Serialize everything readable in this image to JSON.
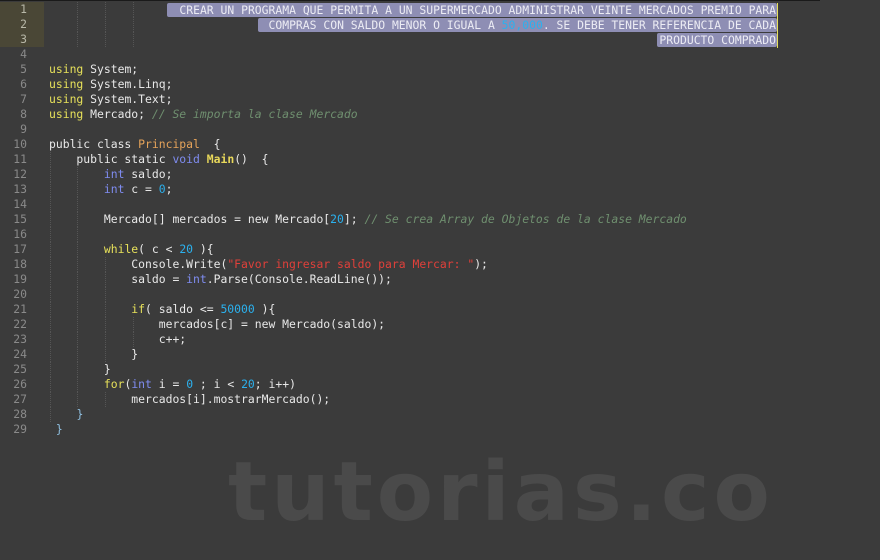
{
  "header_comment": {
    "line1": "CREAR UN PROGRAMA QUE PERMITA A UN SUPERMERCADO ADMINISTRAR VEINTE MERCADOS PREMIO PARA",
    "line2_a": "COMPRAS CON SALDO MENOR O IGUAL A ",
    "line2_num": "50,000",
    "line2_b": ". SE DEBE TENER REFERENCIA DE CADA",
    "line3": "PRODUCTO COMPRADO"
  },
  "line_numbers": [
    "1",
    "2",
    "3",
    "4",
    "5",
    "6",
    "7",
    "8",
    "9",
    "10",
    "11",
    "12",
    "13",
    "14",
    "15",
    "16",
    "17",
    "18",
    "19",
    "20",
    "21",
    "22",
    "23",
    "24",
    "25",
    "26",
    "27",
    "28",
    "29"
  ],
  "code": {
    "l5": {
      "kw": "using",
      "rest": " System;"
    },
    "l6": {
      "kw": "using",
      "rest": " System.Linq;"
    },
    "l7": {
      "kw": "using",
      "rest": " System.Text;"
    },
    "l8": {
      "kw": "using",
      "rest": " Mercado; ",
      "comment": "// Se importa la clase Mercado"
    },
    "l10": {
      "a": "public class ",
      "cls": "Principal",
      "b": "  {"
    },
    "l11": {
      "a": "    public static ",
      "ty": "void",
      "sp": " ",
      "fn": "Main",
      "b": "()  {"
    },
    "l12": {
      "indent": "        ",
      "ty": "int",
      "b": " saldo;"
    },
    "l13": {
      "indent": "        ",
      "ty": "int",
      "b": " c = ",
      "num": "0",
      "c": ";"
    },
    "l15": {
      "a": "        Mercado[] mercados = new Mercado[",
      "num": "20",
      "b": "]; ",
      "comment": "// Se crea Array de Objetos de la clase Mercado"
    },
    "l17": {
      "indent": "        ",
      "kw": "while",
      "a": "( c < ",
      "num": "20",
      "b": " ){"
    },
    "l18": {
      "a": "            Console.Write(",
      "str": "\"Favor ingresar saldo para Mercar: \"",
      "b": ");"
    },
    "l19": {
      "a": "            saldo = ",
      "ty": "int",
      "b": ".Parse(Console.ReadLine());"
    },
    "l21": {
      "indent": "            ",
      "kw": "if",
      "a": "( saldo <= ",
      "num": "50000",
      "b": " ){"
    },
    "l22": {
      "a": "                mercados[c] = new Mercado(saldo);"
    },
    "l23": {
      "a": "                c++;"
    },
    "l24": {
      "a": "            }"
    },
    "l25": {
      "a": "        }"
    },
    "l26": {
      "indent": "        ",
      "kw": "for",
      "a": "(",
      "ty": "int",
      "b": " i = ",
      "num1": "0",
      "c": " ; i < ",
      "num2": "20",
      "d": "; i++)"
    },
    "l27": {
      "a": "            mercados[i].mostrarMercado();"
    },
    "l28": {
      "indent": "    ",
      "brace": "}"
    },
    "l29": {
      "indent": " ",
      "brace": "}"
    }
  },
  "watermark": "tutorias.co",
  "colors": {
    "background": "#3b3b3b",
    "selection": "#8e8eb4",
    "keyword": "#e6e05a",
    "type": "#7f8cf0",
    "class": "#e5a35a",
    "number": "#2bb1ee",
    "string": "#e0403a",
    "comment": "#6f8f6f"
  }
}
